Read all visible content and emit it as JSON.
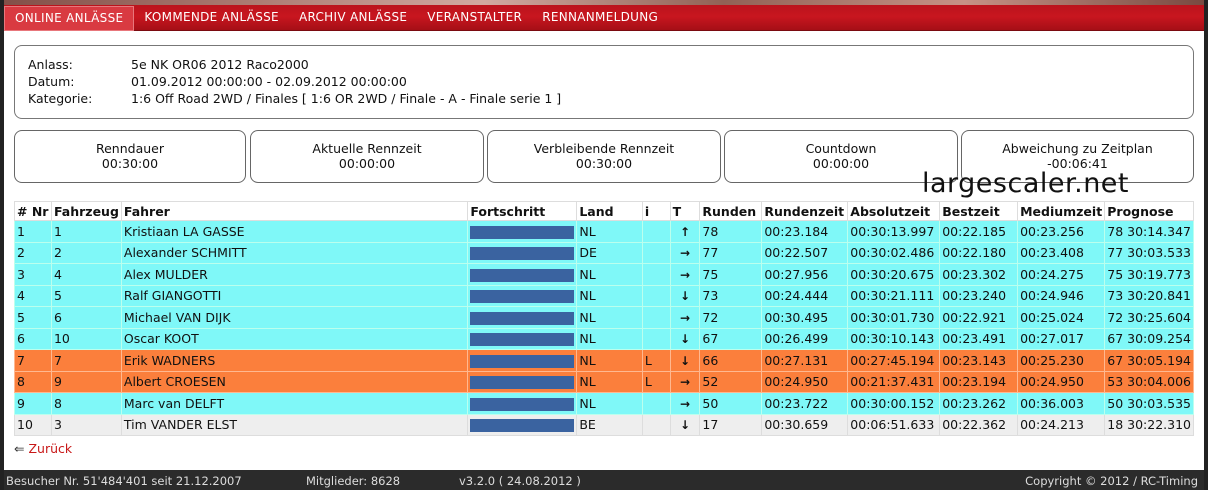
{
  "nav": {
    "items": [
      {
        "label": "ONLINE ANLÄSSE",
        "active": true
      },
      {
        "label": "KOMMENDE ANLÄSSE",
        "active": false
      },
      {
        "label": "ARCHIV ANLÄSSE",
        "active": false
      },
      {
        "label": "VERANSTALTER",
        "active": false
      },
      {
        "label": "RENNANMELDUNG",
        "active": false
      }
    ]
  },
  "event": {
    "anlass_label": "Anlass:",
    "anlass": "5e NK OR06 2012 Raco2000",
    "datum_label": "Datum:",
    "datum": "01.09.2012 00:00:00 - 02.09.2012 00:00:00",
    "kategorie_label": "Kategorie:",
    "kategorie": "1:6 Off Road 2WD / Finales [ 1:6 OR 2WD / Finale - A - Finale serie 1 ]"
  },
  "stats": [
    {
      "title": "Renndauer",
      "value": "00:30:00"
    },
    {
      "title": "Aktuelle Rennzeit",
      "value": "00:00:00"
    },
    {
      "title": "Verbleibende Rennzeit",
      "value": "00:30:00"
    },
    {
      "title": "Countdown",
      "value": "00:00:00"
    },
    {
      "title": "Abweichung zu Zeitplan",
      "value": "-00:06:41"
    }
  ],
  "watermark": "largescaler.net",
  "table": {
    "headers": [
      "# Nr",
      "Fahrzeug",
      "Fahrer",
      "Fortschritt",
      "Land",
      "i",
      "T",
      "Runden",
      "Rundenzeit",
      "Absolutzeit",
      "Bestzeit",
      "Mediumzeit",
      "Prognose"
    ],
    "rows": [
      {
        "nr": "1",
        "fz": "1",
        "fahrer": "Kristiaan LA GASSE",
        "land": "NL",
        "i": "",
        "t": "up",
        "runden": "78",
        "rz": "00:23.184",
        "az": "00:30:13.997",
        "bz": "00:22.185",
        "mz": "00:23.256",
        "prog": "78 30:14.347",
        "color": "cyan"
      },
      {
        "nr": "2",
        "fz": "2",
        "fahrer": "Alexander SCHMITT",
        "land": "DE",
        "i": "",
        "t": "right",
        "runden": "77",
        "rz": "00:22.507",
        "az": "00:30:02.486",
        "bz": "00:22.180",
        "mz": "00:23.408",
        "prog": "77 30:03.533",
        "color": "cyan"
      },
      {
        "nr": "3",
        "fz": "4",
        "fahrer": "Alex MULDER",
        "land": "NL",
        "i": "",
        "t": "right",
        "runden": "75",
        "rz": "00:27.956",
        "az": "00:30:20.675",
        "bz": "00:23.302",
        "mz": "00:24.275",
        "prog": "75 30:19.773",
        "color": "cyan"
      },
      {
        "nr": "4",
        "fz": "5",
        "fahrer": "Ralf GIANGOTTI",
        "land": "NL",
        "i": "",
        "t": "down",
        "runden": "73",
        "rz": "00:24.444",
        "az": "00:30:21.111",
        "bz": "00:23.240",
        "mz": "00:24.946",
        "prog": "73 30:20.841",
        "color": "cyan"
      },
      {
        "nr": "5",
        "fz": "6",
        "fahrer": "Michael VAN DIJK",
        "land": "NL",
        "i": "",
        "t": "right",
        "runden": "72",
        "rz": "00:30.495",
        "az": "00:30:01.730",
        "bz": "00:22.921",
        "mz": "00:25.024",
        "prog": "72 30:25.604",
        "color": "cyan"
      },
      {
        "nr": "6",
        "fz": "10",
        "fahrer": "Oscar KOOT",
        "land": "NL",
        "i": "",
        "t": "down",
        "runden": "67",
        "rz": "00:26.499",
        "az": "00:30:10.143",
        "bz": "00:23.491",
        "mz": "00:27.017",
        "prog": "67 30:09.254",
        "color": "cyan"
      },
      {
        "nr": "7",
        "fz": "7",
        "fahrer": "Erik WADNERS",
        "land": "NL",
        "i": "L",
        "t": "down",
        "runden": "66",
        "rz": "00:27.131",
        "az": "00:27:45.194",
        "bz": "00:23.143",
        "mz": "00:25.230",
        "prog": "67 30:05.194",
        "color": "orange"
      },
      {
        "nr": "8",
        "fz": "9",
        "fahrer": "Albert CROESEN",
        "land": "NL",
        "i": "L",
        "t": "right",
        "runden": "52",
        "rz": "00:24.950",
        "az": "00:21:37.431",
        "bz": "00:23.194",
        "mz": "00:24.950",
        "prog": "53 30:04.006",
        "color": "orange"
      },
      {
        "nr": "9",
        "fz": "8",
        "fahrer": "Marc van DELFT",
        "land": "NL",
        "i": "",
        "t": "right",
        "runden": "50",
        "rz": "00:23.722",
        "az": "00:30:00.152",
        "bz": "00:23.262",
        "mz": "00:36.003",
        "prog": "50 30:03.535",
        "color": "cyan"
      },
      {
        "nr": "10",
        "fz": "3",
        "fahrer": "Tim VANDER ELST",
        "land": "BE",
        "i": "",
        "t": "down",
        "runden": "17",
        "rz": "00:30.659",
        "az": "00:06:51.633",
        "bz": "00:22.362",
        "mz": "00:24.213",
        "prog": "18 30:22.310",
        "color": "grey"
      }
    ]
  },
  "back_label": "Zurück",
  "footer": {
    "visitors": "Besucher Nr. 51'484'401 seit 21.12.2007",
    "members": "Mitglieder: 8628",
    "version": "v3.2.0 ( 24.08.2012 )",
    "copyright": "Copyright © 2012 / RC-Timing"
  },
  "colors": {
    "topbar": "#c8161f",
    "row_cyan": "#7ff8f8",
    "row_orange": "#fb7f3c",
    "row_grey": "#eeeeee",
    "progress": "#3a63a0"
  }
}
